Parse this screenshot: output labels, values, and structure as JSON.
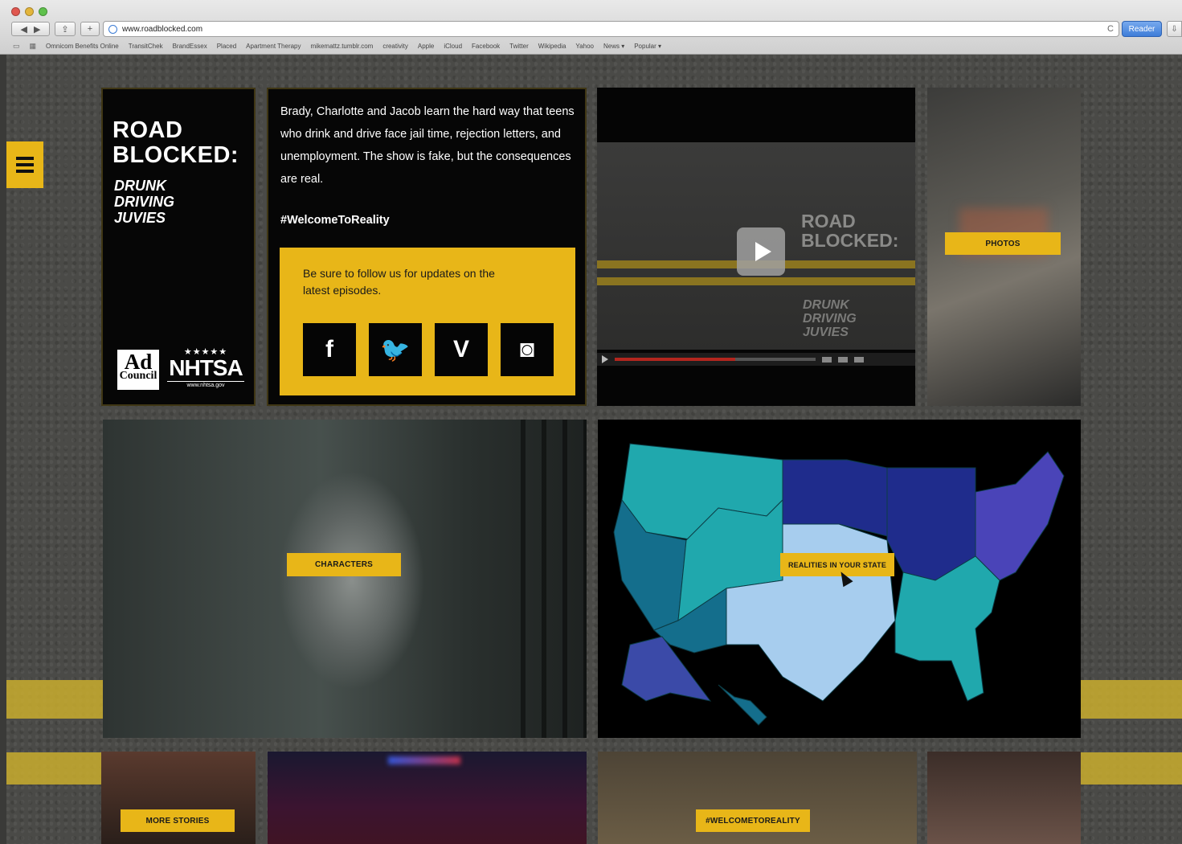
{
  "browser": {
    "url": "www.roadblocked.com",
    "reader_label": "Reader",
    "bookmarks": [
      "Omnicom Benefits Online",
      "TransitChek",
      "BrandEssex",
      "Placed",
      "Apartment Therapy",
      "mikemattz.tumblr.com",
      "creativity",
      "Apple",
      "iCloud",
      "Facebook",
      "Twitter",
      "Wikipedia",
      "Yahoo",
      "News ▾",
      "Popular ▾"
    ]
  },
  "title_tile": {
    "title_line1": "ROAD",
    "title_line2": "BLOCKED:",
    "sub_line1": "DRUNK",
    "sub_line2": "DRIVING",
    "sub_line3": "JUVIES",
    "logo_ad_top": "Ad",
    "logo_ad_bottom": "Council",
    "logo_nhtsa": "NHTSA",
    "logo_nhtsa_stars": "★★★★★",
    "logo_nhtsa_url": "www.nhtsa.gov"
  },
  "description": {
    "text": "Brady, Charlotte and Jacob learn the hard way that teens who drink and drive face jail time, rejection letters, and unemployment. The show is fake, but the consequences are real.",
    "hashtag": "#WelcomeToReality",
    "follow_text": "Be sure to follow us for updates on the latest episodes.",
    "social": [
      {
        "name": "facebook",
        "glyph": "f"
      },
      {
        "name": "twitter",
        "glyph": "🐦"
      },
      {
        "name": "vine",
        "glyph": "V"
      },
      {
        "name": "instagram",
        "glyph": "◙"
      }
    ]
  },
  "video": {
    "title_line1": "ROAD",
    "title_line2": "BLOCKED:",
    "sub_line1": "DRUNK",
    "sub_line2": "DRIVING",
    "sub_line3": "JUVIES",
    "progress": 0.6
  },
  "labels": {
    "photos": "PHOTOS",
    "characters": "CHARACTERS",
    "map": "REALITIES IN YOUR STATE",
    "more_stories": "MORE STORIES",
    "welcome": "#WELCOMETOREALITY"
  },
  "colors": {
    "accent": "#e8b618",
    "map_teal": "#20a8ad",
    "map_dark_teal": "#146e8c",
    "map_navy": "#1f2c8c",
    "map_purple": "#4a44b8",
    "map_light": "#a7cdee"
  }
}
